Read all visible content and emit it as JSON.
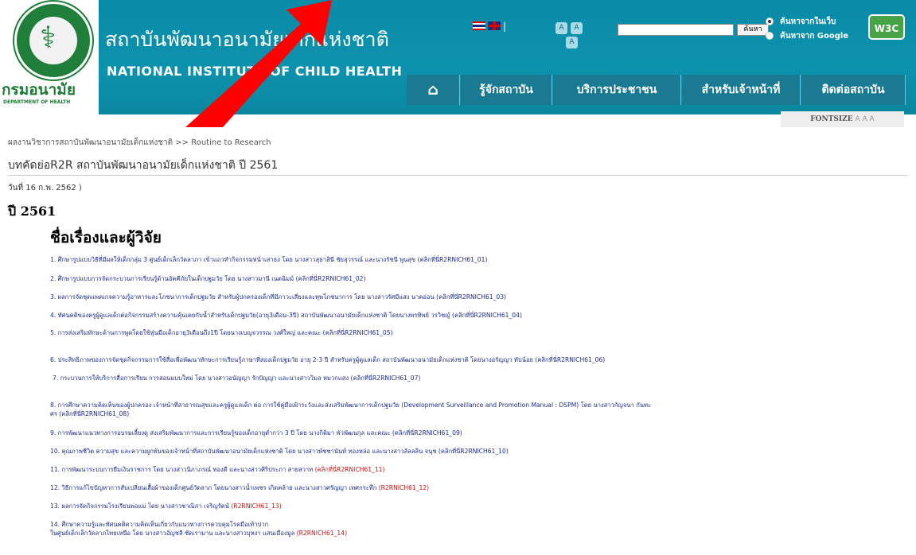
{
  "header": {
    "dept_name_th": "กรมอนามัย",
    "dept_name_en": "DEPARTMENT OF HEALTH",
    "site_title_th": "สถาบันพัฒนาอนามัยเด็กแห่งชาติ",
    "site_title_en": "NATIONAL INSTITUTE OF CHILD HEALTH",
    "font_buttons": [
      "A",
      "A",
      "A"
    ],
    "search": {
      "placeholder": "",
      "button_label": "ค้นหา"
    },
    "search_options": [
      "ค้นหาจากในเว็บ",
      "ค้นหาจาก Google"
    ],
    "w3c_badge": "W3C",
    "nav": [
      "รู้จักสถาบัน",
      "บริการประชาชน",
      "สำหรับเจ้าหน้าที่",
      "ติดต่อสถาบัน"
    ]
  },
  "fontsize": {
    "label": "FONTSIZE",
    "sizes": [
      "A",
      "A",
      "A"
    ]
  },
  "breadcrumb": "ผลงานวิชาการสถาบันพัฒนาอนามัยเด็กแห่งชาติ >> Routine to Research",
  "article": {
    "title": "บทคัดย่อR2R สถาบันพัฒนาอนามัยเด็กแห่งชาติ ปี 2561",
    "date": "วันที่ 16 ก.พ. 2562 )",
    "year": "ปี 2561",
    "section_heading": "ชื่อเรื่องและผู้วิจัย"
  },
  "items": [
    {
      "text": "1. ศึกษารูปแบบวิธีที่มีผลให้เด็กกลุ่ม 3 ศูนย์เด็กเล็กวัดลาภา เข้าแถวทำกิจกรรมหน้าเสาธง  โดย นางสาวสุธาสินี ชัยสุวรรณ์ และนางรัชนี พูนสุข  (คลิกที่นี่R2RNICH61_01)",
      "code": ""
    },
    {
      "text": "2. ศึกษารูปแบบการจัดกระบวนการเรียนรู้ด้านอัคคีภัยในเด็กปฐมวัย โดย นางสาวมานี เนตฉิมม์ (คลิกที่นี่R2RNICH61_02)",
      "code": ""
    },
    {
      "text": "3. ผลการจัดชุดแพคเกจความรู้อาหารและโภชนาการเด็กปฐมวัย สำหรับผู้ปกครองเด็กที่มีภาวะเสี่ยงและทุพโภชนาการ โดย นางสาวรัศมีแสง นาคอ่อน (คลิกที่นี่R2RNICH61_03)",
      "code": ""
    },
    {
      "text": "4. ทัศนคติของครูผู้ดูแลเด็กต่อกิจกรรมสร้างความคุ้นเคยกับน้ำสำหรับเด็กปฐมวัย(อายุ3เดือน-3ปี) สถาบันพัฒนาอนามัยเด็กแห่งชาติ โดยนางพรทิพย์ วรวิชญ์ (คลิกที่นี่R2RNICH61_04)",
      "code": ""
    },
    {
      "text": "5. การส่งเสริมทักษะด้านการพูดโดยใช้หุ่นมือเด็กอายุ3เดือนถึง1ปี โดยนางเบญจวรรณ วงศ์ใหญ่ และคณะ (คลิกที่นี่R2RNICH61_05)",
      "code": ""
    },
    {
      "text": "6. ประสิทธิภาพของการจัดชุดกิจกรรมการใช้สื่อเพื่อพัฒนาทักษะการเรียนรู้ภาษาที่สองเด็กปฐมวัย อายุ 2-3 ปี สำหรับครูผู้ดูแลเด็ก สถาบันพัฒนาอนามัยเด็กแห่งชาติ โดยนางอรัญญา ทับน้อย (คลิกที่นี่R2RNICH61_06)",
      "code": ""
    },
    {
      "text": "7. กระบวนการให้บริการสื่อการเรียน การสอนแบบใหม่ โดย นางสาวอนัญญา รักปัญญา และนางสาววิมล หมวกแสง (คลิกที่นี่R2RNICH61_07)",
      "code": ""
    },
    {
      "text": "8. การศึกษาความคิดเห็นของผู้ปกครอง เจ้าหน้าที่สาธารณสุขและครูผู้ดูแลเด็ก ต่อ การใช้คู่มือเฝ้าระวังและส่งเสริมพัฒนาการเด็กปฐมวัย (Development Surveillance and Promotion Manual : DSPM) โดย นางสาวกัญจนา กันทะ",
      "code": ""
    },
    {
      "text": "ศร (คลิกที่นี่R2RNICH61_08)",
      "code": ""
    },
    {
      "text": "9. การพัฒนาแนวทางการอบรมเลี้ยงดู ส่งเสริมพัฒนาการและการเรียนรู้ของเด็กอายุต่ำกว่า 3 ปี โดย นางกิติมา พัวพัฒนกุล และคณะ (คลิกที่นี่R2RNICH61_09)",
      "code": ""
    },
    {
      "text": "10. คุณภาพชีวิต ความสุข และความผูกพันของเจ้าหน้าที่สถาบันพัฒนาอนามัยเด็กแห่งชาติ โดย นางสาวพัชชานันท์ ทองหล่อ และนางสาวลัลลลิน จนุช (คลิกที่นี่R2RNICH61_10)",
      "code": ""
    },
    {
      "text": "11. การพัฒนาระบบการยืมเงินราชการ โดย นางสาวนิภาภรณ์ ทองดี และนางสาวศิริประภา สายสวาท ",
      "code": "(คลิกที่นี่R2RNICH61_11)"
    },
    {
      "text": "12. วิธีการแก้ไขปัญหาการสับเปลี่ยนเสื้อผ้าของเด็กศูนย์วัดลาภ โดยนางสาวน้ำเพชร เกิดคล้าย และนางสาวศรัญญา เทศกระทึก ",
      "code": "(R2RNICH61_12)"
    },
    {
      "text": "13. ผลการจัดกิจกรรมโรงเรียนพ่อแม่ โดย นางสาวชาณิภา เจริญรัตน์ ",
      "code": "(R2RNICH61_13)"
    },
    {
      "text": "14. ศึกษาความรู้และทัศนคติความคิดเห็นเกี่ยวกับแนวทางการควบคุมโรคมือเท้าปาก",
      "code": ""
    },
    {
      "text": "ในศูนย์เด็กเล็กวัดลาภไทยเหนือ โดย นางสาวอัญชลี ชัดเรามาน และนางสาวบุหงา แสนเมืองมูล ",
      "code": "(R2RNICH61_14)"
    }
  ],
  "colors": {
    "header_teal": "#0c92ad",
    "nav_dark": "#1a7a92",
    "link_blue": "#1a2a8a",
    "code_red": "#cc1111",
    "annotation_arrow": "#ff0000"
  }
}
